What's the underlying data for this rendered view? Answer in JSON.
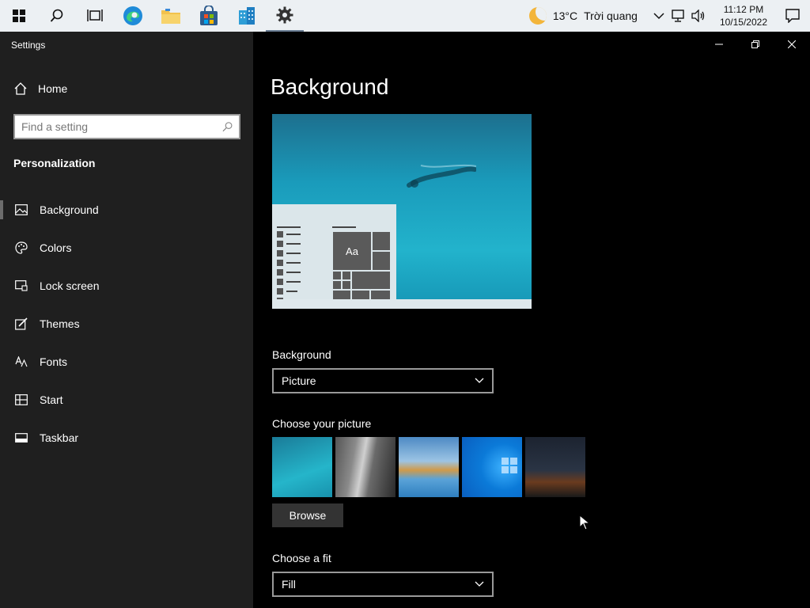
{
  "taskbar": {
    "weather_temp": "13°C",
    "weather_text": "Trời quang",
    "time": "11:12 PM",
    "date": "10/15/2022"
  },
  "window": {
    "title": "Settings"
  },
  "sidebar": {
    "home_label": "Home",
    "search_placeholder": "Find a setting",
    "section_title": "Personalization",
    "items": [
      {
        "label": "Background",
        "icon": "picture-icon"
      },
      {
        "label": "Colors",
        "icon": "palette-icon"
      },
      {
        "label": "Lock screen",
        "icon": "lock-screen-icon"
      },
      {
        "label": "Themes",
        "icon": "themes-icon"
      },
      {
        "label": "Fonts",
        "icon": "fonts-icon"
      },
      {
        "label": "Start",
        "icon": "start-icon"
      },
      {
        "label": "Taskbar",
        "icon": "taskbar-icon"
      }
    ]
  },
  "content": {
    "title": "Background",
    "preview_tile_text": "Aa",
    "background_label": "Background",
    "background_value": "Picture",
    "choose_picture_label": "Choose your picture",
    "browse_label": "Browse",
    "fit_label": "Choose a fit",
    "fit_value": "Fill"
  }
}
